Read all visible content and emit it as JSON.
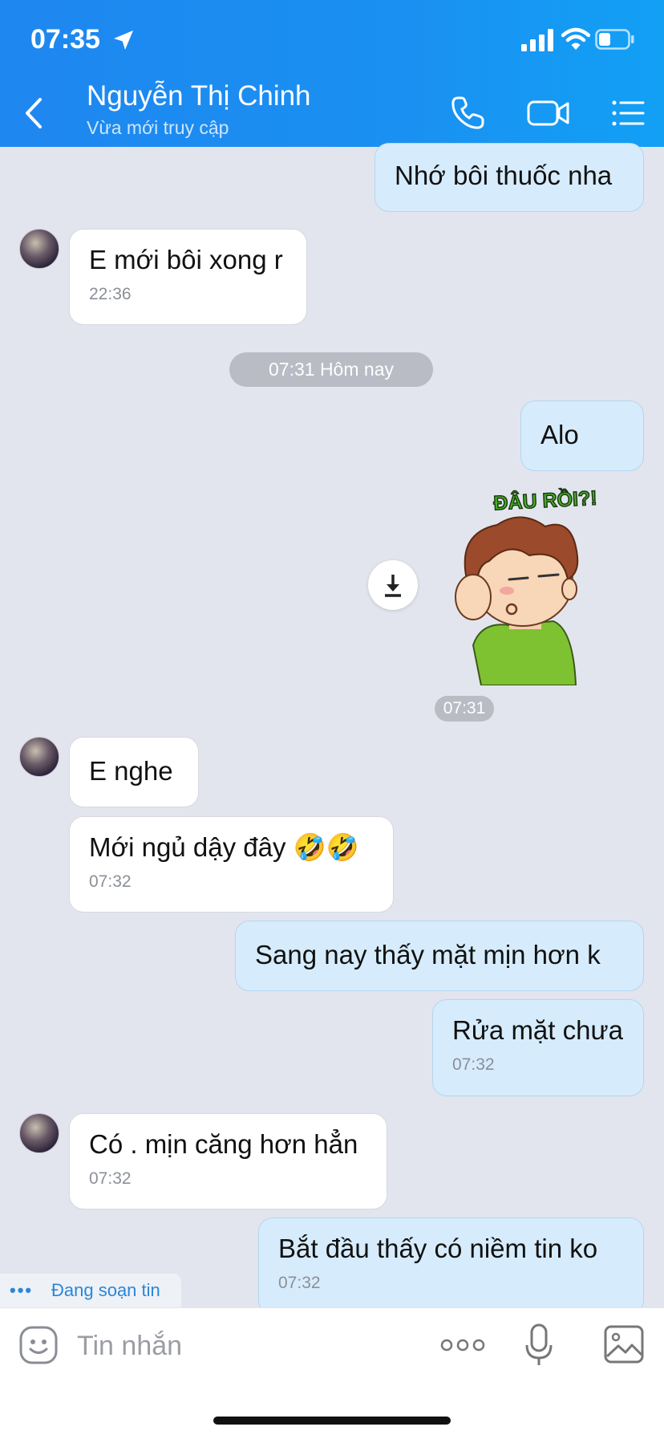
{
  "status_bar": {
    "time": "07:35"
  },
  "header": {
    "contact_name": "Nguyễn Thị Chinh",
    "contact_status": "Vừa mới truy cập",
    "icons": [
      "back-icon",
      "phone-icon",
      "video-camera-icon",
      "list-menu-icon"
    ]
  },
  "messages": {
    "m1": {
      "text": "Nhớ bôi thuốc nha"
    },
    "m2": {
      "text": "E mới bôi xong r",
      "time": "22:36"
    },
    "date_separator": "07:31 Hôm nay",
    "m3": {
      "text": "Alo"
    },
    "sticker": {
      "caption": "ĐÂU RỒI?!",
      "time": "07:31"
    },
    "m4": {
      "text": "E nghe"
    },
    "m5": {
      "text": "Mới ngủ dậy đây 🤣🤣",
      "time": "07:32"
    },
    "m6": {
      "text": "Sang nay thấy mặt mịn hơn k"
    },
    "m7": {
      "text": "Rửa mặt chưa",
      "time": "07:32"
    },
    "m8": {
      "text": "Có . mịn căng hơn hẳn",
      "time": "07:32"
    },
    "m9": {
      "text": "Bắt đầu thấy có niềm tin ko",
      "time": "07:32"
    }
  },
  "typing_indicator": "Đang soạn tin",
  "composer": {
    "placeholder": "Tin nhắn",
    "icons": [
      "emoji-icon",
      "more-icon",
      "microphone-icon",
      "image-icon"
    ]
  },
  "colors": {
    "header": "#1e87f0",
    "outgoing_bubble": "#d6ecfd",
    "incoming_bubble": "#ffffff",
    "chat_background": "#e2e5ee"
  }
}
